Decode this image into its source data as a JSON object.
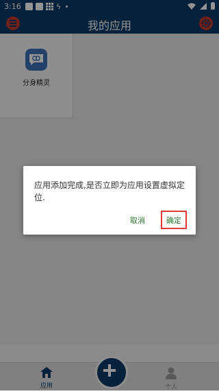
{
  "status_bar": {
    "time": "3:16"
  },
  "app_bar": {
    "title": "我的应用"
  },
  "app_list": [
    {
      "name": "分身精灵"
    }
  ],
  "dialog": {
    "message": "应用添加完成,是否立即为应用设置虚拟定位.",
    "cancel_label": "取消",
    "confirm_label": "确定"
  },
  "bottom_nav": {
    "apps_label": "应用",
    "profile_label": "个人"
  },
  "colors": {
    "primary": "#0b3a66",
    "accent_red": "#c0392b",
    "dialog_button": "#2e7d32",
    "highlight": "#e53935"
  }
}
